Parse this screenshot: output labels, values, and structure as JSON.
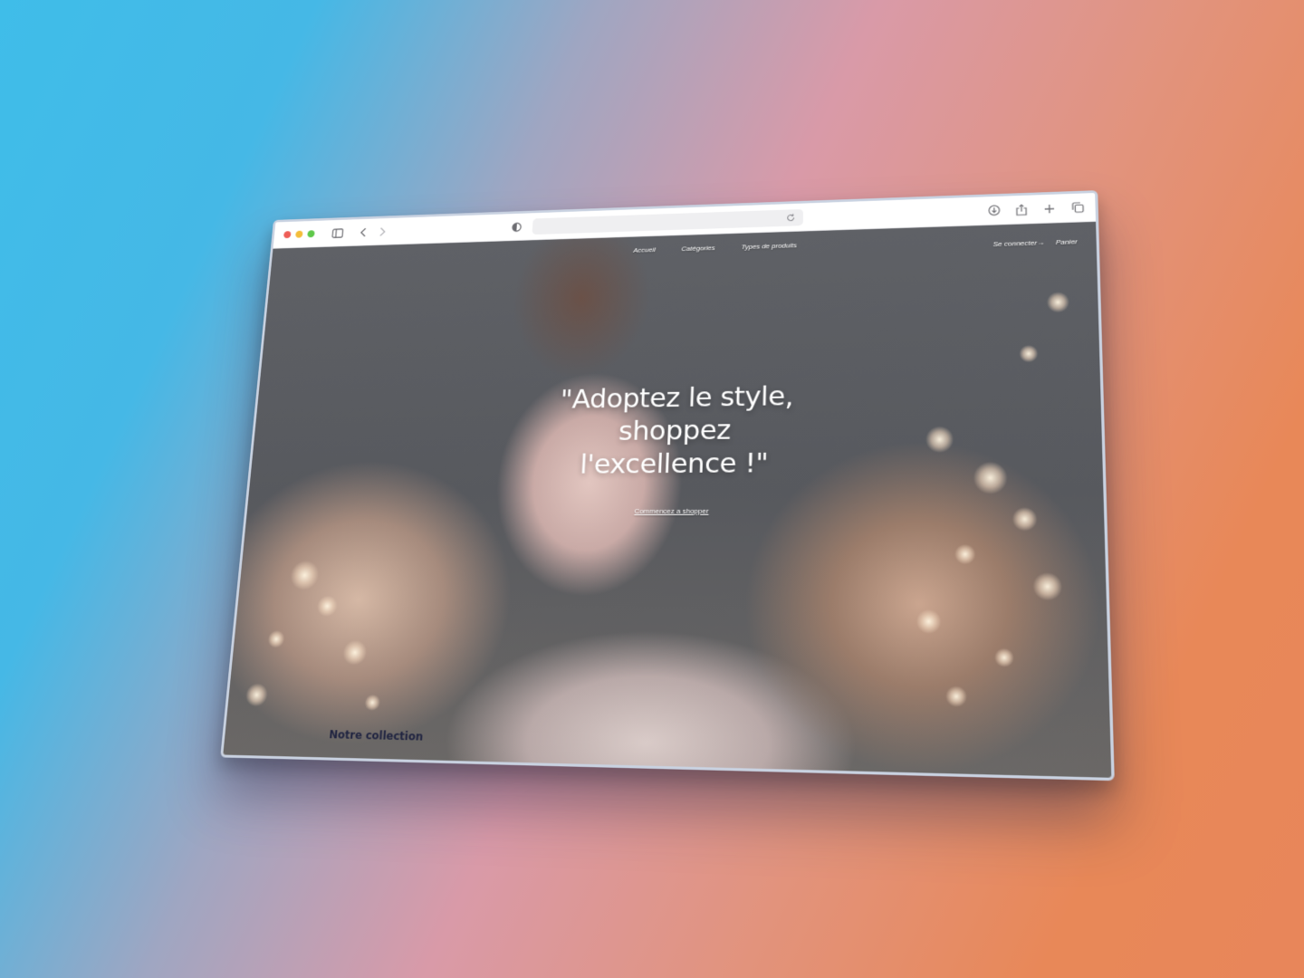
{
  "browser": {
    "url": "",
    "icons": [
      "sidebar-icon",
      "back-icon",
      "forward-icon",
      "shield-icon",
      "reload-icon",
      "download-icon",
      "share-icon",
      "new-tab-icon",
      "tabs-overview-icon"
    ]
  },
  "nav": {
    "links": [
      "Accueil",
      "Catégories",
      "Types de produits"
    ],
    "login": "Se connecter→",
    "cart": "Panier"
  },
  "hero": {
    "title": "\"Adoptez le style, shoppez l'excellence !\"",
    "cta": "Commencez a shopper"
  },
  "section": {
    "title": "Notre collection"
  },
  "colors": {
    "traffic_red": "#ee5e57",
    "traffic_yellow": "#f4bd3a",
    "traffic_green": "#5fc84a",
    "section_title": "#1f2340"
  }
}
